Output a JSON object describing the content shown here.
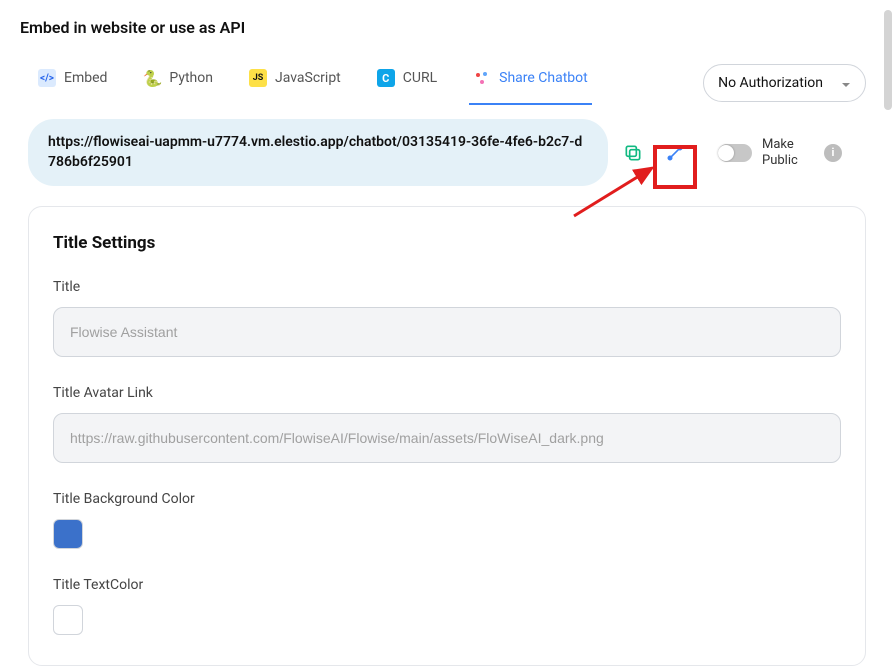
{
  "header": {
    "title": "Embed in website or use as API"
  },
  "tabs": {
    "embed": "Embed",
    "python": "Python",
    "javascript": "JavaScript",
    "curl": "CURL",
    "share": "Share Chatbot"
  },
  "auth": {
    "label": "No Authorization"
  },
  "url": {
    "value": "https://flowiseai-uapmm-u7774.vm.elestio.app/chatbot/03135419-36fe-4fe6-b2c7-d786b6f25901"
  },
  "makePublic": {
    "label": "Make Public"
  },
  "settings": {
    "heading": "Title Settings",
    "titleLabel": "Title",
    "titlePlaceholder": "Flowise Assistant",
    "avatarLabel": "Title Avatar Link",
    "avatarPlaceholder": "https://raw.githubusercontent.com/FlowiseAI/Flowise/main/assets/FloWiseAI_dark.png",
    "bgColorLabel": "Title Background Color",
    "textColorLabel": "Title TextColor"
  },
  "colors": {
    "titleBg": "#3b71ca",
    "titleText": "#ffffff"
  }
}
